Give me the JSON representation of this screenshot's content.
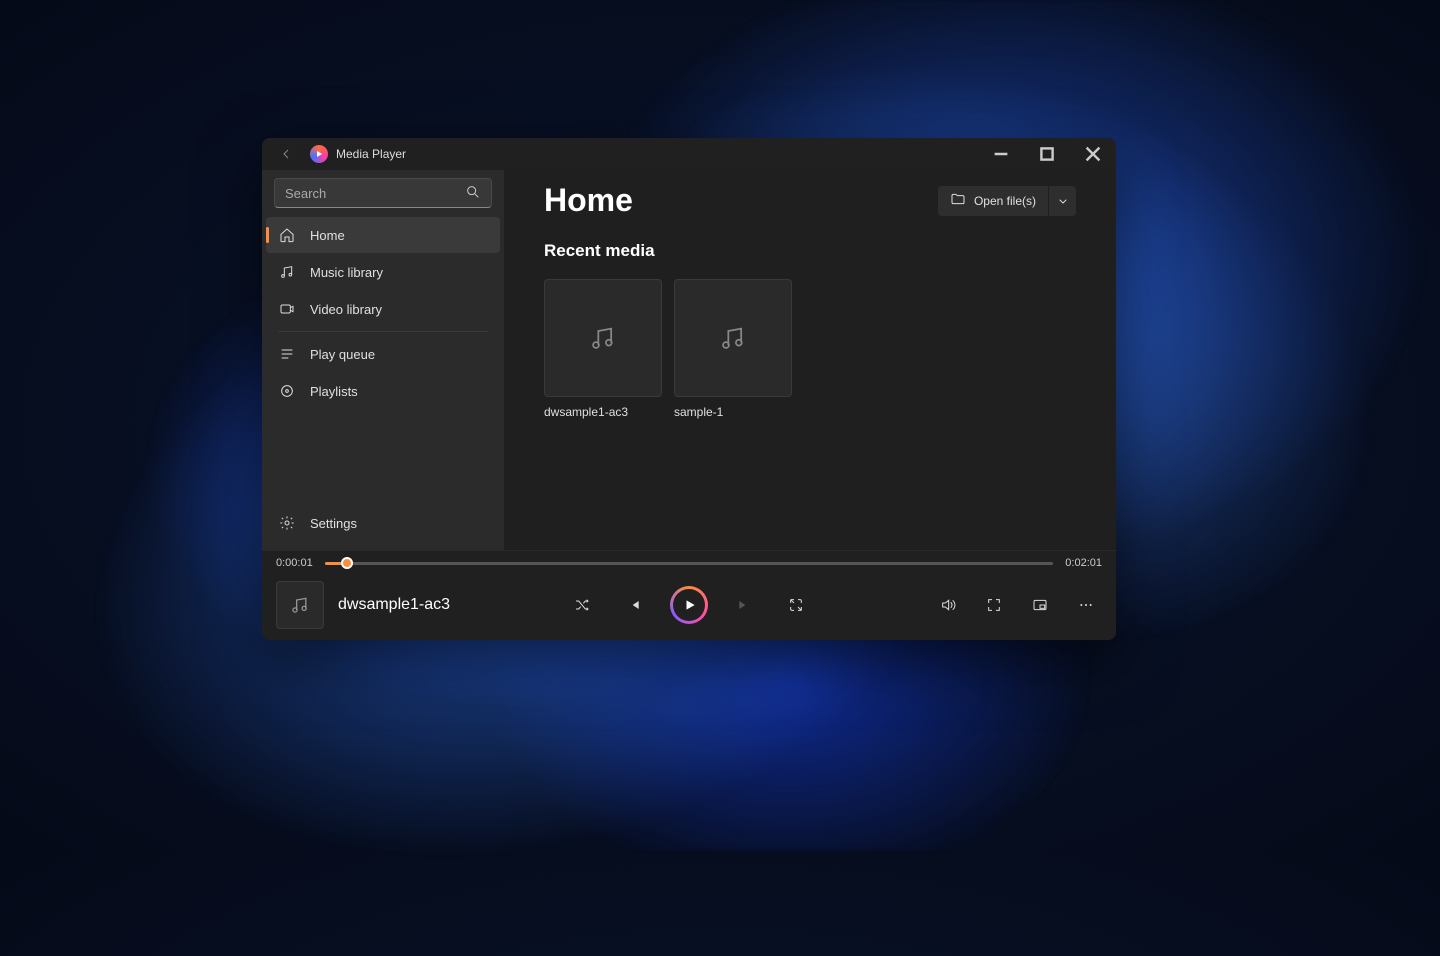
{
  "app": {
    "title": "Media Player"
  },
  "search": {
    "placeholder": "Search"
  },
  "sidebar": {
    "items": [
      {
        "label": "Home"
      },
      {
        "label": "Music library"
      },
      {
        "label": "Video library"
      },
      {
        "label": "Play queue"
      },
      {
        "label": "Playlists"
      }
    ],
    "settings_label": "Settings"
  },
  "main": {
    "title": "Home",
    "open_file_label": "Open file(s)",
    "section_title": "Recent media",
    "recent": [
      {
        "label": "dwsample1-ac3"
      },
      {
        "label": "sample-1"
      }
    ]
  },
  "player": {
    "current_time": "0:00:01",
    "total_time": "0:02:01",
    "now_playing": "dwsample1-ac3"
  }
}
